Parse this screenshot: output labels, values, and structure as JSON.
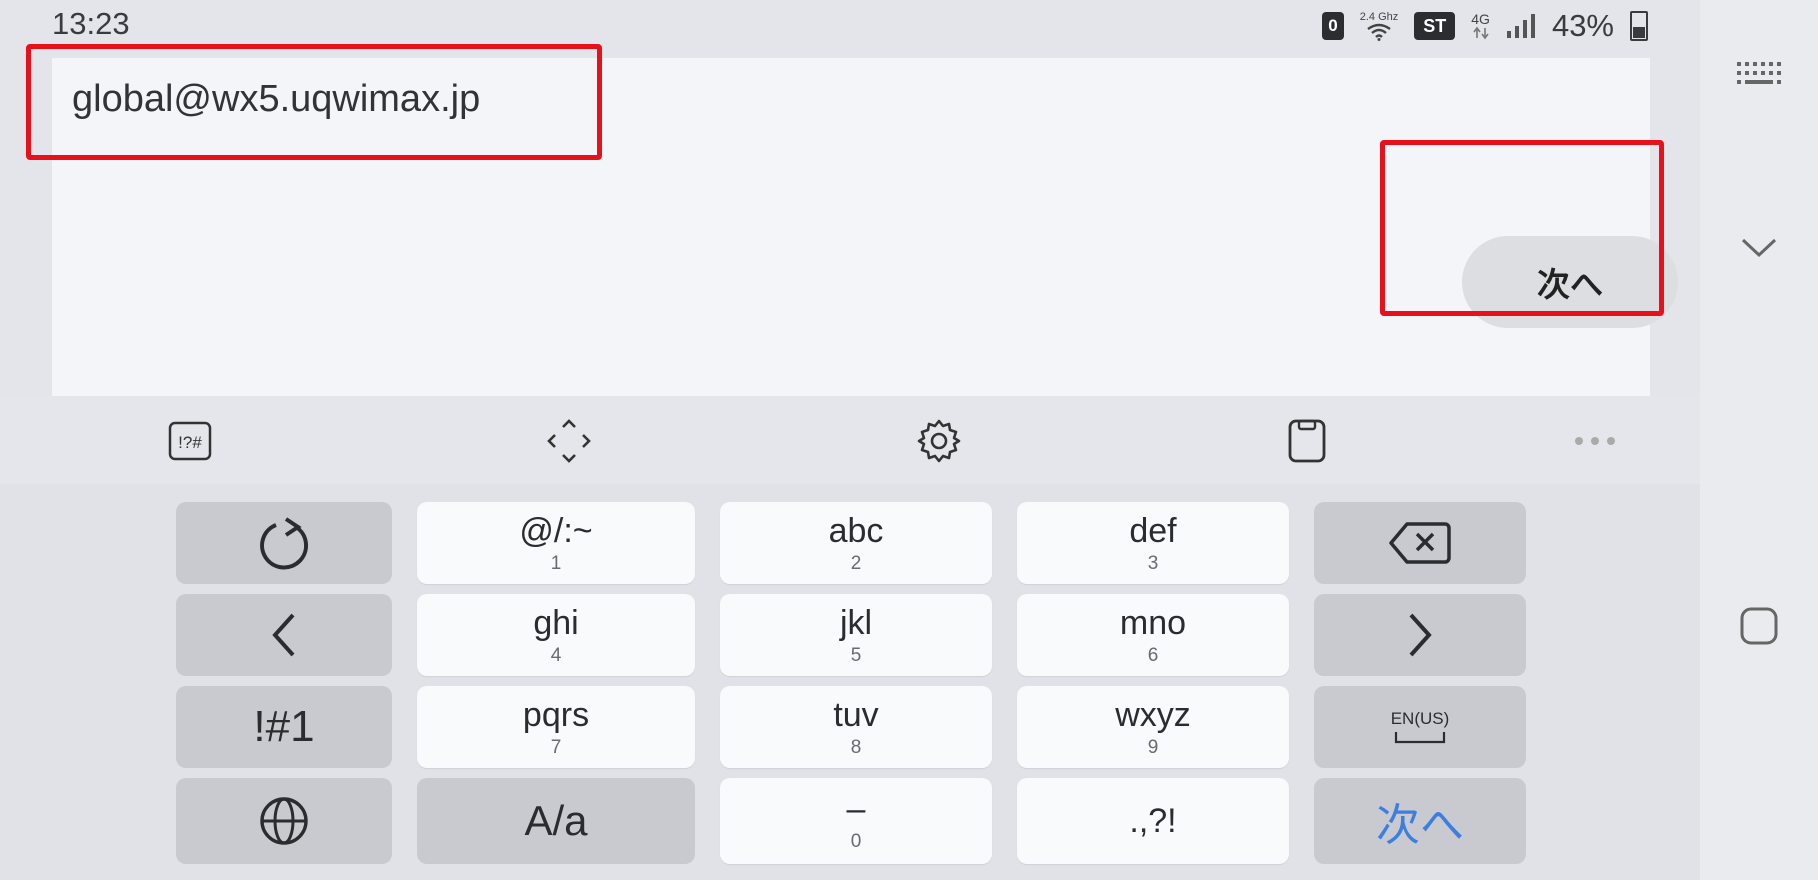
{
  "status_bar": {
    "time": "13:23",
    "badge_zero": "0",
    "wifi_band": "2.4 Ghz",
    "badge_st": "ST",
    "network_type": "4G",
    "battery_percent": "43%"
  },
  "input": {
    "value": "global@wx5.uqwimax.jp",
    "next_button_label": "次へ"
  },
  "toolbar": {
    "items": [
      "symbols-icon",
      "cursor-move-icon",
      "settings-icon",
      "clipboard-icon",
      "more-icon"
    ],
    "symbols_label": "!?#"
  },
  "keyboard": {
    "rows": [
      [
        {
          "type": "icon",
          "name": "undo-icon"
        },
        {
          "main": "@/:~",
          "sub": "1"
        },
        {
          "main": "abc",
          "sub": "2"
        },
        {
          "main": "def",
          "sub": "3"
        },
        {
          "type": "icon",
          "name": "backspace-icon"
        }
      ],
      [
        {
          "type": "icon",
          "name": "cursor-left-icon"
        },
        {
          "main": "ghi",
          "sub": "4"
        },
        {
          "main": "jkl",
          "sub": "5"
        },
        {
          "main": "mno",
          "sub": "6"
        },
        {
          "type": "icon",
          "name": "cursor-right-icon"
        }
      ],
      [
        {
          "main": "!#1"
        },
        {
          "main": "pqrs",
          "sub": "7"
        },
        {
          "main": "tuv",
          "sub": "8"
        },
        {
          "main": "wxyz",
          "sub": "9"
        },
        {
          "main": "EN(US)",
          "sub": "space"
        }
      ],
      [
        {
          "type": "icon",
          "name": "globe-icon"
        },
        {
          "main": "A/a"
        },
        {
          "main": "–",
          "sub": "0"
        },
        {
          "main": ".,?!"
        },
        {
          "main": "次へ"
        }
      ]
    ],
    "accent_color": "#3d7fe0"
  },
  "highlight_color": "#e8101b"
}
